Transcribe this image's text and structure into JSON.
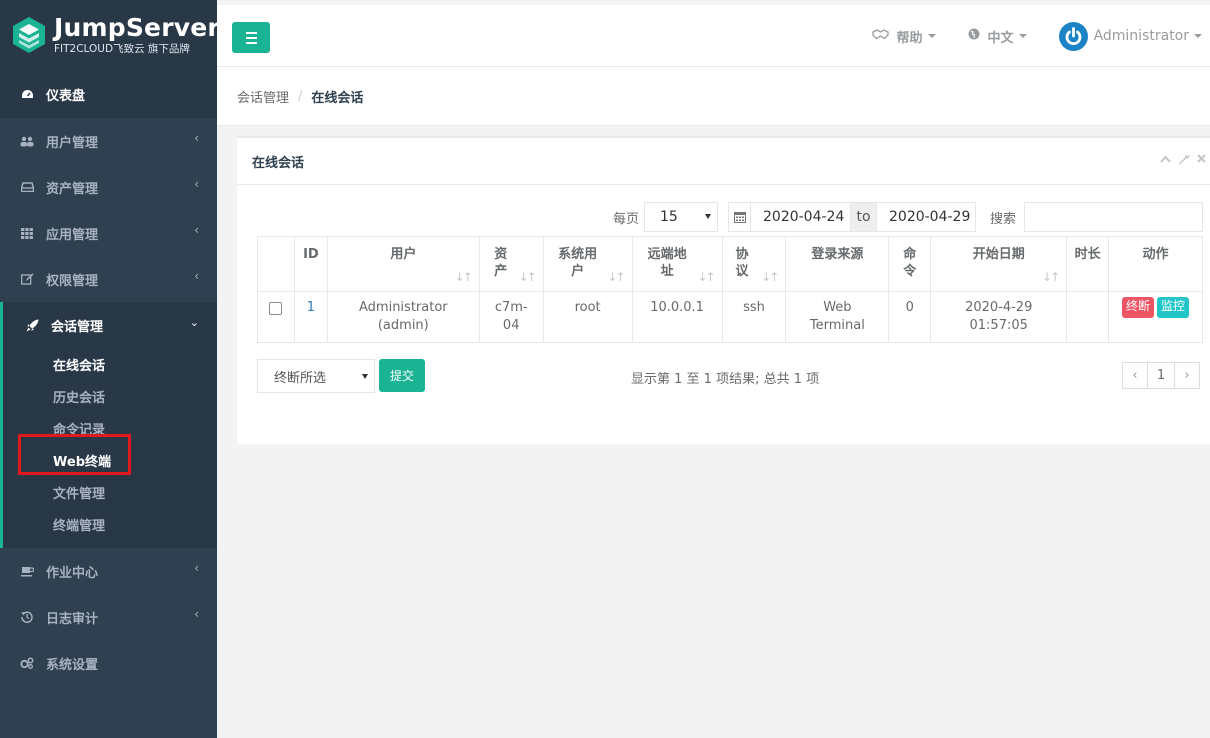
{
  "colors": {
    "accent": "#1ab394",
    "sidebar": "#2f4050",
    "danger": "#ed5565",
    "info": "#23c6c8",
    "highlight": "#e2191c"
  },
  "brand": {
    "title": "JumpServer",
    "subtitle": "FIT2CLOUD飞致云 旗下品牌"
  },
  "sidebar": {
    "dashboard": "仪表盘",
    "items": [
      {
        "label": "用户管理",
        "icon": "users-icon"
      },
      {
        "label": "资产管理",
        "icon": "inbox-icon"
      },
      {
        "label": "应用管理",
        "icon": "th-icon"
      },
      {
        "label": "权限管理",
        "icon": "edit-icon"
      }
    ],
    "active_group": {
      "label": "会话管理",
      "icon": "rocket-icon",
      "subitems": [
        {
          "label": "在线会话",
          "active": true
        },
        {
          "label": "历史会话",
          "active": false
        },
        {
          "label": "命令记录",
          "active": false
        },
        {
          "label": "Web终端",
          "active": false
        },
        {
          "label": "文件管理",
          "active": false
        },
        {
          "label": "终端管理",
          "active": false
        }
      ]
    },
    "items_after": [
      {
        "label": "作业中心",
        "icon": "coffee-icon"
      },
      {
        "label": "日志审计",
        "icon": "history-icon"
      },
      {
        "label": "系统设置",
        "icon": "cogs-icon"
      }
    ]
  },
  "topbar": {
    "help": "帮助",
    "language": "中文",
    "user": "Administrator"
  },
  "breadcrumb": {
    "parent": "会话管理",
    "separator": "/",
    "current": "在线会话"
  },
  "panel": {
    "title": "在线会话"
  },
  "controls": {
    "per_page_label": "每页",
    "per_page_value": "15",
    "date_from": "2020-04-24",
    "date_to_label": "to",
    "date_to": "2020-04-29",
    "search_label": "搜索",
    "search_value": ""
  },
  "table": {
    "headers": [
      "ID",
      "用户",
      "资产",
      "系统用户",
      "远端地址",
      "协议",
      "登录来源",
      "命令",
      "开始日期",
      "时长",
      "动作"
    ],
    "rows": [
      {
        "id": "1",
        "user": "Administrator (admin)",
        "asset": "c7m-04",
        "system_user": "root",
        "remote_addr": "10.0.0.1",
        "protocol": "ssh",
        "login_from": "Web Terminal",
        "command": "0",
        "date_start": "2020-4-29 01:57:05",
        "duration": "",
        "actions": [
          "终断",
          "监控"
        ]
      }
    ]
  },
  "bulk": {
    "select_value": "终断所选",
    "submit": "提交"
  },
  "pagination": {
    "info": "显示第 1 至 1 项结果; 总共 1 项",
    "prev": "‹",
    "page": "1",
    "next": "›"
  }
}
